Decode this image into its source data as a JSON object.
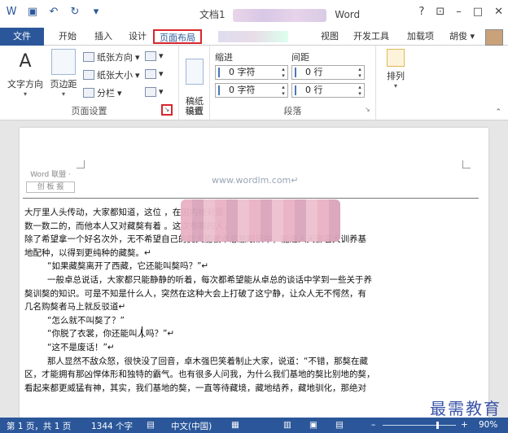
{
  "window": {
    "title_prefix": "文档1",
    "title_suffix": "Word",
    "help": "?",
    "restore": "⊡",
    "minimize": "–",
    "maximize": "□",
    "close": "✕"
  },
  "qat": {
    "undo_label": "↶",
    "redo_label": "↻",
    "save_label": "▣",
    "word_label": "W",
    "more_label": "▾"
  },
  "tabs": [
    "文件",
    "开始",
    "插入",
    "设计",
    "页面布局",
    "视图",
    "开发工具",
    "加载项",
    "胡俊 ▾"
  ],
  "ribbon": {
    "page_setup": {
      "text_direction": "文字方向",
      "margins": "页边距",
      "orientation": "纸张方向",
      "size": "纸张大小",
      "columns": "分栏",
      "label": "页面设置"
    },
    "draft": {
      "draft_settings": "稿纸\n设置",
      "label": "稿纸"
    },
    "paragraph": {
      "indent": "缩进",
      "spacing": "间距",
      "indent_left": "0 字符",
      "indent_right": "0 字符",
      "space_before": "0 行",
      "space_after": "0 行",
      "label": "段落"
    },
    "arrange": {
      "label": "排列"
    }
  },
  "document": {
    "header_logo_line1": "Word 联盟 ·",
    "header_logo_line2": "创 板 报",
    "header_url": "www.wordlm.com↵",
    "lines": [
      "大厅里人头传动，大家都知道，这位                                               ，在国内绝对是",
      "数一数二的，而他本人又对藏獒有着                                               。这次参赛的人，",
      "除了希望拿一个好名次外，无不希望自己的獒犬能被卓总慧眼识中，能进入天御名犬训养基",
      "地配种，以得到更纯种的藏獒。↵",
      "“如果藏獒离开了西藏，它还能叫獒吗？”↵",
      "一般卓总说话，大家都只能静静的听着，每次都希望能从卓总的谈话中学到一些关于养",
      "獒训獒的知识。可是不知是什么人，突然在这种大会上打破了这宁静，让众人无不愕然，有",
      "几名购獒者马上就反驳道↵",
      "“怎么就不叫獒了？”",
      "“你脱了衣裳，你还能叫人吗？”↵",
      "“这不是废话！”↵",
      "那人显然不敌众怒，很快没了回音，卓木强巴笑着制止大家，说道：“不错，那獒在藏",
      "区，才能拥有那凶悍体形和独特的霸气。也有很多人问我，为什么我们基地的獒比别地的獒，",
      "看起来都更威猛有神，其实，我们基地的獒，一直等待藏境，藏地结养，藏地驯化，那绝对"
    ],
    "indented_lines": [
      4,
      5,
      8,
      9,
      10,
      11
    ]
  },
  "watermark": "最需教育",
  "status": {
    "page": "第 1 页，共 1 页",
    "words": "1344 个字",
    "lang": "中文(中国)",
    "zoom": "90%",
    "zoom_minus": "–",
    "zoom_plus": "+"
  }
}
